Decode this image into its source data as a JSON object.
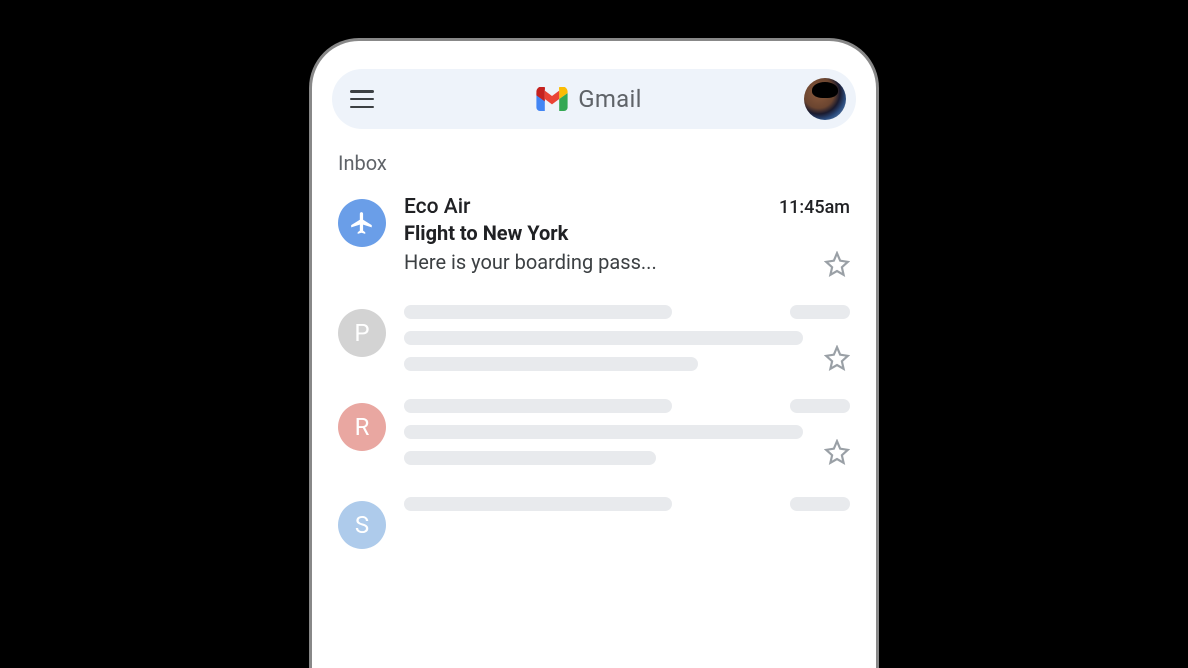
{
  "header": {
    "app_name": "Gmail"
  },
  "inbox": {
    "label": "Inbox",
    "emails": [
      {
        "sender": "Eco Air",
        "time": "11:45am",
        "subject": "Flight to New York",
        "preview": "Here is your boarding pass...",
        "avatar_type": "plane",
        "avatar_color": "blue"
      }
    ],
    "placeholder_initials": [
      "P",
      "R",
      "S"
    ]
  }
}
